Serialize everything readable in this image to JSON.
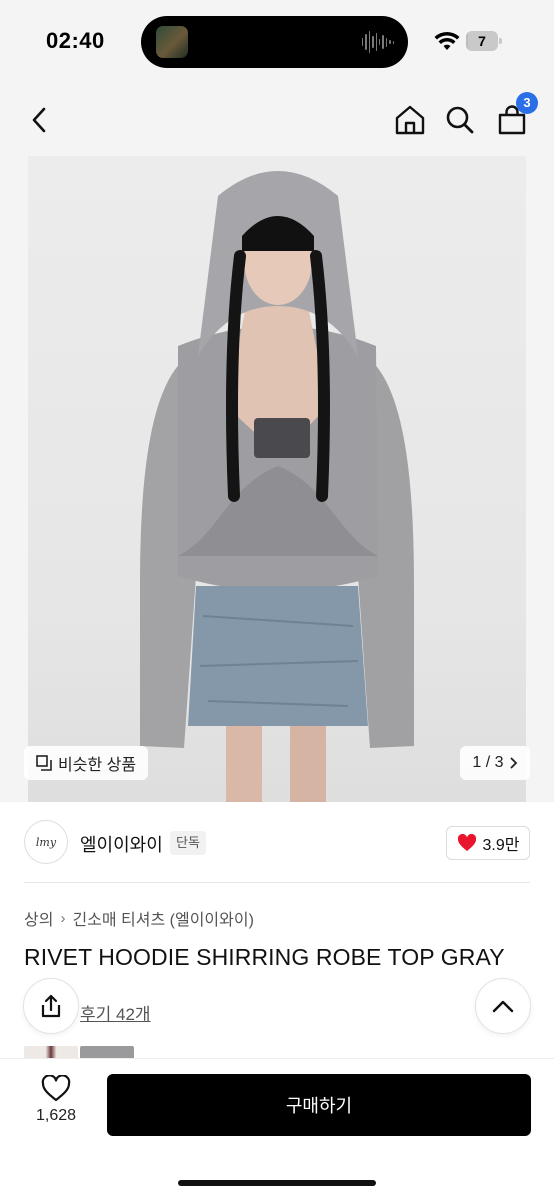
{
  "status_bar": {
    "time": "02:40",
    "battery": "7",
    "battery_level": 0.07
  },
  "nav": {
    "cart_count": "3"
  },
  "gallery": {
    "similar_label": "비슷한 상품",
    "page_indicator": "1 / 3"
  },
  "brand": {
    "logo_text": "lmy",
    "name": "엘이이와이",
    "tag": "단독",
    "likes": "3.9만"
  },
  "breadcrumb": [
    "상의",
    "긴소매 티셔츠 (엘이이와이)"
  ],
  "product": {
    "title": "RIVET HOODIE SHIRRING ROBE TOP GRAY",
    "reviews": "후기 42개"
  },
  "bottom": {
    "wish_count": "1,628",
    "buy_label": "구매하기"
  },
  "colors": {
    "accent_blue": "#2b6fe6",
    "heart_red": "#e8152c",
    "buy_button": "#000000"
  }
}
